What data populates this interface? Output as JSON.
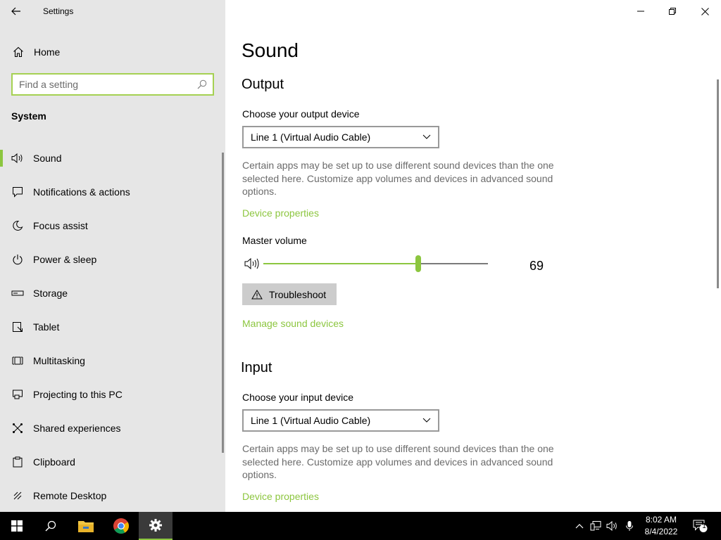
{
  "window": {
    "title": "Settings"
  },
  "sidebar": {
    "home_label": "Home",
    "search_placeholder": "Find a setting",
    "section_title": "System",
    "items": [
      {
        "label": "Sound",
        "icon": "speaker-icon",
        "active": true
      },
      {
        "label": "Notifications & actions",
        "icon": "notifications-icon"
      },
      {
        "label": "Focus assist",
        "icon": "moon-icon"
      },
      {
        "label": "Power & sleep",
        "icon": "power-icon"
      },
      {
        "label": "Storage",
        "icon": "storage-icon"
      },
      {
        "label": "Tablet",
        "icon": "tablet-icon"
      },
      {
        "label": "Multitasking",
        "icon": "multitasking-icon"
      },
      {
        "label": "Projecting to this PC",
        "icon": "projecting-icon"
      },
      {
        "label": "Shared experiences",
        "icon": "shared-experiences-icon"
      },
      {
        "label": "Clipboard",
        "icon": "clipboard-icon"
      },
      {
        "label": "Remote Desktop",
        "icon": "remote-desktop-icon"
      }
    ]
  },
  "main": {
    "page_title": "Sound",
    "output": {
      "heading": "Output",
      "device_label": "Choose your output device",
      "device_value": "Line 1 (Virtual Audio Cable)",
      "description": "Certain apps may be set up to use different sound devices than the one selected here. Customize app volumes and devices in advanced sound options.",
      "device_properties_link": "Device properties",
      "master_volume_label": "Master volume",
      "volume_value": "69",
      "volume_level": 69,
      "troubleshoot_label": "Troubleshoot",
      "manage_link": "Manage sound devices"
    },
    "input": {
      "heading": "Input",
      "device_label": "Choose your input device",
      "device_value": "Line 1 (Virtual Audio Cable)",
      "description": "Certain apps may be set up to use different sound devices than the one selected here. Customize app volumes and devices in advanced sound options.",
      "device_properties_link": "Device properties"
    }
  },
  "taskbar": {
    "time": "8:02 AM",
    "date": "8/4/2022",
    "notification_count": "1"
  },
  "colors": {
    "accent": "#8cc63f",
    "sidebar_bg": "#e6e6e6",
    "taskbar_bg": "#000000"
  }
}
